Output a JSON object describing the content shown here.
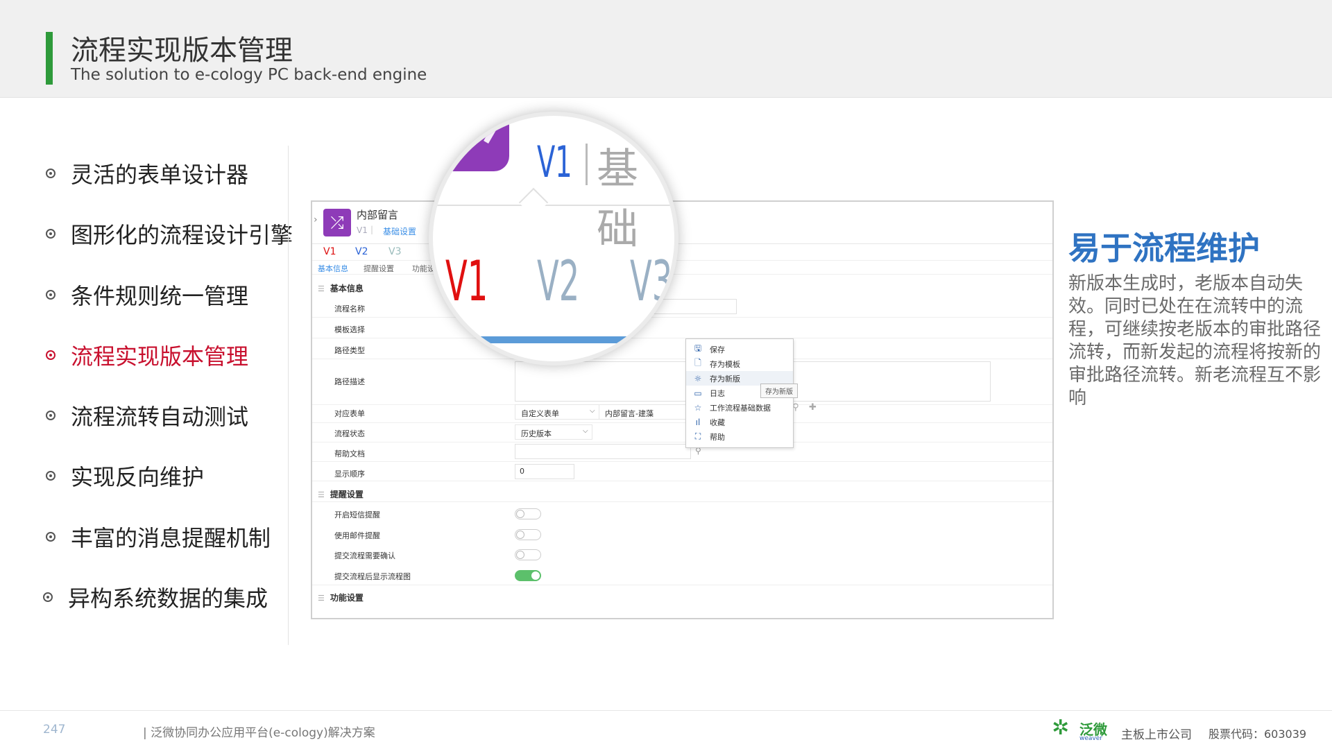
{
  "header": {
    "title": "流程实现版本管理",
    "subtitle": "The solution to e-cology PC back-end engine"
  },
  "nav": {
    "items": [
      {
        "label": "灵活的表单设计器",
        "active": false
      },
      {
        "label": "图形化的流程设计引擎",
        "active": false
      },
      {
        "label": "条件规则统一管理",
        "active": false
      },
      {
        "label": "流程实现版本管理",
        "active": true
      },
      {
        "label": "流程流转自动测试",
        "active": false
      },
      {
        "label": "实现反向维护",
        "active": false
      },
      {
        "label": "丰富的消息提醒机制",
        "active": false
      },
      {
        "label": "异构系统数据的集成",
        "active": false
      }
    ]
  },
  "app": {
    "name": "内部留言",
    "small_version": "V1",
    "separator": "|",
    "basic_tab": "基础设置",
    "back_arrow": "›",
    "icon": "shuffle-icon",
    "version_tabs": [
      "V1",
      "V2",
      "V3"
    ],
    "sub_tabs": [
      "基本信息",
      "提醒设置",
      "功能设"
    ],
    "sections": {
      "basic": "基本信息",
      "remind": "提醒设置",
      "func": "功能设置"
    },
    "fields": {
      "flow_name": "流程名称",
      "template": "模板选择",
      "path_type": "路径类型",
      "path_desc": "路径描述",
      "form": "对应表单",
      "status": "流程状态",
      "help_doc": "帮助文档",
      "display_order": "显示顺序"
    },
    "values": {
      "form_type": "自定义表单",
      "form_name": "内部留言-建藻",
      "status": "历史版本",
      "display_order": "0"
    },
    "reminders": [
      {
        "label": "开启短信提醒",
        "on": false
      },
      {
        "label": "使用邮件提醒",
        "on": false
      },
      {
        "label": "提交流程需要确认",
        "on": false
      },
      {
        "label": "提交流程后显示流程图",
        "on": true
      }
    ]
  },
  "context_menu": {
    "items": [
      {
        "icon": "save-icon",
        "glyph": "🖫",
        "label": "保存"
      },
      {
        "icon": "template-icon",
        "glyph": "🗋",
        "label": "存为模板"
      },
      {
        "icon": "new-version-icon",
        "glyph": "☼",
        "label": "存为新版"
      },
      {
        "icon": "log-icon",
        "glyph": "▭",
        "label": "日志"
      },
      {
        "icon": "star-icon",
        "glyph": "☆",
        "label": "工作流程基础数据"
      },
      {
        "icon": "chart-icon",
        "glyph": "ıl",
        "label": "收藏"
      },
      {
        "icon": "help-icon",
        "glyph": "⛶",
        "label": "帮助"
      }
    ],
    "tooltip": "存为新版"
  },
  "magnifier": {
    "top_version": "V1",
    "top_tab": "基础",
    "versions": [
      "V1",
      "V2",
      "V3"
    ]
  },
  "right_panel": {
    "title": "易于流程维护",
    "description": "新版本生成时，老版本自动失效。同时已处在在流转中的流程，可继续按老版本的审批路径流转，而新发起的流程将按新的审批路径流转。新老流程互不影响"
  },
  "footer": {
    "page_number": "247",
    "text": "| 泛微协同办公应用平台(e-cology)解决方案",
    "logo_text": "泛微",
    "logo_sub": "weaver",
    "company": "主板上市公司",
    "stock_code": "股票代码：603039"
  },
  "colors": {
    "accent_green": "#2e9a3a",
    "active_red": "#c8102e",
    "title_blue": "#2f73c2",
    "app_purple": "#8e3bb8"
  }
}
